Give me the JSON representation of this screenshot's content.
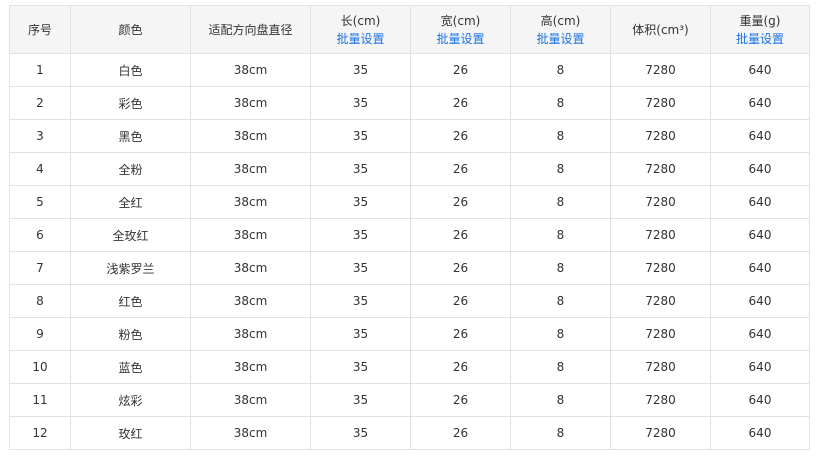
{
  "header": {
    "index": "序号",
    "color": "颜色",
    "wheel": "适配方向盘直径",
    "length": "长(cm)",
    "width": "宽(cm)",
    "height": "高(cm)",
    "volume": "体积(cm³)",
    "weight": "重量(g)",
    "batch_label": "批量设置"
  },
  "rows": [
    {
      "index": "1",
      "color": "白色",
      "wheel": "38cm",
      "length": "35",
      "width": "26",
      "height": "8",
      "volume": "7280",
      "weight": "640"
    },
    {
      "index": "2",
      "color": "彩色",
      "wheel": "38cm",
      "length": "35",
      "width": "26",
      "height": "8",
      "volume": "7280",
      "weight": "640"
    },
    {
      "index": "3",
      "color": "黑色",
      "wheel": "38cm",
      "length": "35",
      "width": "26",
      "height": "8",
      "volume": "7280",
      "weight": "640"
    },
    {
      "index": "4",
      "color": "全粉",
      "wheel": "38cm",
      "length": "35",
      "width": "26",
      "height": "8",
      "volume": "7280",
      "weight": "640"
    },
    {
      "index": "5",
      "color": "全红",
      "wheel": "38cm",
      "length": "35",
      "width": "26",
      "height": "8",
      "volume": "7280",
      "weight": "640"
    },
    {
      "index": "6",
      "color": "全玫红",
      "wheel": "38cm",
      "length": "35",
      "width": "26",
      "height": "8",
      "volume": "7280",
      "weight": "640"
    },
    {
      "index": "7",
      "color": "浅紫罗兰",
      "wheel": "38cm",
      "length": "35",
      "width": "26",
      "height": "8",
      "volume": "7280",
      "weight": "640"
    },
    {
      "index": "8",
      "color": "红色",
      "wheel": "38cm",
      "length": "35",
      "width": "26",
      "height": "8",
      "volume": "7280",
      "weight": "640"
    },
    {
      "index": "9",
      "color": "粉色",
      "wheel": "38cm",
      "length": "35",
      "width": "26",
      "height": "8",
      "volume": "7280",
      "weight": "640"
    },
    {
      "index": "10",
      "color": "蓝色",
      "wheel": "38cm",
      "length": "35",
      "width": "26",
      "height": "8",
      "volume": "7280",
      "weight": "640"
    },
    {
      "index": "11",
      "color": "炫彩",
      "wheel": "38cm",
      "length": "35",
      "width": "26",
      "height": "8",
      "volume": "7280",
      "weight": "640"
    },
    {
      "index": "12",
      "color": "玫红",
      "wheel": "38cm",
      "length": "35",
      "width": "26",
      "height": "8",
      "volume": "7280",
      "weight": "640"
    }
  ],
  "colors": {
    "link": "#1a73e8",
    "header_bg": "#f5f5f5",
    "border": "#e2e2e2",
    "text": "#333333"
  }
}
